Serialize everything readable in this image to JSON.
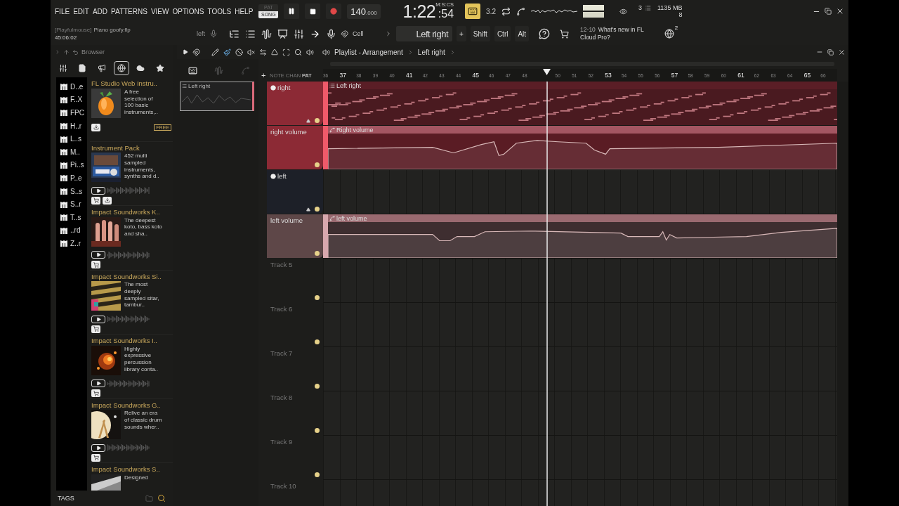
{
  "menu": [
    "FILE",
    "EDIT",
    "ADD",
    "PATTERNS",
    "VIEW",
    "OPTIONS",
    "TOOLS",
    "HELP"
  ],
  "transport": {
    "modes": [
      {
        "label": "PAT",
        "selected": false
      },
      {
        "label": "SONG",
        "selected": true
      }
    ],
    "tempo": "140",
    "tempo_fraction": ".000",
    "time": "1:22",
    "time_hundredths": ":54",
    "time_format": "M:S:CS",
    "typing_keyboard": {
      "on": true
    },
    "countdown": "3.2"
  },
  "monitor": {
    "cpu": "3",
    "memory": "1135 MB",
    "polyphony": "8"
  },
  "project": {
    "author": "[Playfulmouse]",
    "file": "Piano goofy.flp",
    "time": "45:06:02"
  },
  "toolbar": {
    "hint": "left",
    "snap": "Cell",
    "pattern": "Left right",
    "keys": [
      "+",
      "Shift",
      "Ctrl",
      "Alt"
    ],
    "news_date": "12-10",
    "news": "What's new in FL Cloud Pro?",
    "notifications": "2"
  },
  "browser": {
    "title": "Browser",
    "tabs": [
      {
        "selected": false
      },
      {
        "selected": false
      },
      {
        "selected": false
      },
      {
        "selected": true
      },
      {
        "selected": false
      },
      {
        "selected": false
      }
    ],
    "folders": [
      "D..e",
      "F..X",
      "FPC",
      "H..r",
      "L..s",
      "M..",
      "Pi..s",
      "P..e",
      "S..s",
      "S..r",
      "T..s",
      "..rd",
      "Z..r"
    ],
    "products": [
      {
        "title": "FL Studio Web Instru..",
        "description": "A free selection of 100 basic instruments,..",
        "badge": "FREE",
        "preview": false,
        "cart": false,
        "download": true
      },
      {
        "title": "Instrument Pack",
        "description": "452 multi sampled instruments, synths and d..",
        "preview": true,
        "cart": true,
        "download": true
      },
      {
        "title": "Impact Soundworks K..",
        "description": "The deepest koto, bass koto and sha..",
        "preview": true,
        "cart": true,
        "download": false
      },
      {
        "title": "Impact Soundworks Si..",
        "description": "The most deeply sampled sitar, tambur..",
        "preview": true,
        "cart": true,
        "download": false
      },
      {
        "title": "Impact Soundworks I..",
        "description": "Highly expressive percussion library conta..",
        "preview": true,
        "cart": true,
        "download": false
      },
      {
        "title": "Impact Soundworks G..",
        "description": "Relive an era of classic drum sounds wher..",
        "preview": true,
        "cart": true,
        "download": false
      },
      {
        "title": "Impact Soundworks S..",
        "description": "Designed",
        "preview": false,
        "cart": false,
        "download": false
      }
    ],
    "tags": "TAGS"
  },
  "picker": {
    "clip": "Left right"
  },
  "playlist": {
    "title": "Playlist - Arrangement",
    "pattern": "Left right",
    "add_track": "+",
    "filters": [
      {
        "label": "NOTE",
        "selected": false
      },
      {
        "label": "CHAN",
        "selected": false
      },
      {
        "label": "PAT",
        "selected": true
      }
    ],
    "ruler": [
      {
        "kind": "bar",
        "label": "36",
        "major": false
      },
      {
        "kind": "bar",
        "label": "37",
        "major": true
      },
      {
        "kind": "bar",
        "label": "38",
        "major": false
      },
      {
        "kind": "bar",
        "label": "39",
        "major": false
      },
      {
        "kind": "bar",
        "label": "40",
        "major": false
      },
      {
        "kind": "bar",
        "label": "41",
        "major": true
      },
      {
        "kind": "bar",
        "label": "42",
        "major": false
      },
      {
        "kind": "bar",
        "label": "43",
        "major": false
      },
      {
        "kind": "bar",
        "label": "44",
        "major": false
      },
      {
        "kind": "bar",
        "label": "45",
        "major": true
      },
      {
        "kind": "bar",
        "label": "46",
        "major": false
      },
      {
        "kind": "bar",
        "label": "47",
        "major": false
      },
      {
        "kind": "bar",
        "label": "48",
        "major": false
      },
      {
        "kind": "playhead"
      },
      {
        "kind": "bar",
        "label": "50",
        "major": false
      },
      {
        "kind": "bar",
        "label": "51",
        "major": false
      },
      {
        "kind": "bar",
        "label": "52",
        "major": false
      },
      {
        "kind": "bar",
        "label": "53",
        "major": true
      },
      {
        "kind": "bar",
        "label": "54",
        "major": false
      },
      {
        "kind": "bar",
        "label": "55",
        "major": false
      },
      {
        "kind": "bar",
        "label": "56",
        "major": false
      },
      {
        "kind": "bar",
        "label": "57",
        "major": true
      },
      {
        "kind": "bar",
        "label": "58",
        "major": false
      },
      {
        "kind": "bar",
        "label": "59",
        "major": false
      },
      {
        "kind": "bar",
        "label": "60",
        "major": false
      },
      {
        "kind": "bar",
        "label": "61",
        "major": true
      },
      {
        "kind": "bar",
        "label": "62",
        "major": false
      },
      {
        "kind": "bar",
        "label": "63",
        "major": false
      },
      {
        "kind": "bar",
        "label": "64",
        "major": false
      },
      {
        "kind": "bar",
        "label": "65",
        "major": true
      },
      {
        "kind": "bar",
        "label": "66",
        "major": false
      }
    ],
    "tracks": [
      {
        "name": "right",
        "kind": "pattern",
        "clip": "Left right",
        "color": "#8c2a35",
        "info_icon": true
      },
      {
        "name": "right volume",
        "kind": "automation",
        "clip": "Right volume",
        "color": "#8c2a35",
        "info_icon": false
      },
      {
        "name": "left",
        "kind": "empty",
        "color": "#1d2028",
        "info_icon": true
      },
      {
        "name": "left volume",
        "kind": "automation",
        "clip": "left volume",
        "color": "#5e4748",
        "info_icon": false
      },
      {
        "name": "Track 5",
        "kind": "empty",
        "info_icon": false
      },
      {
        "name": "Track 6",
        "kind": "empty",
        "info_icon": false
      },
      {
        "name": "Track 7",
        "kind": "empty",
        "info_icon": false
      },
      {
        "name": "Track 8",
        "kind": "empty",
        "info_icon": false
      },
      {
        "name": "Track 9",
        "kind": "empty",
        "info_icon": false
      },
      {
        "name": "Track 10",
        "kind": "empty",
        "info_icon": false
      }
    ]
  }
}
